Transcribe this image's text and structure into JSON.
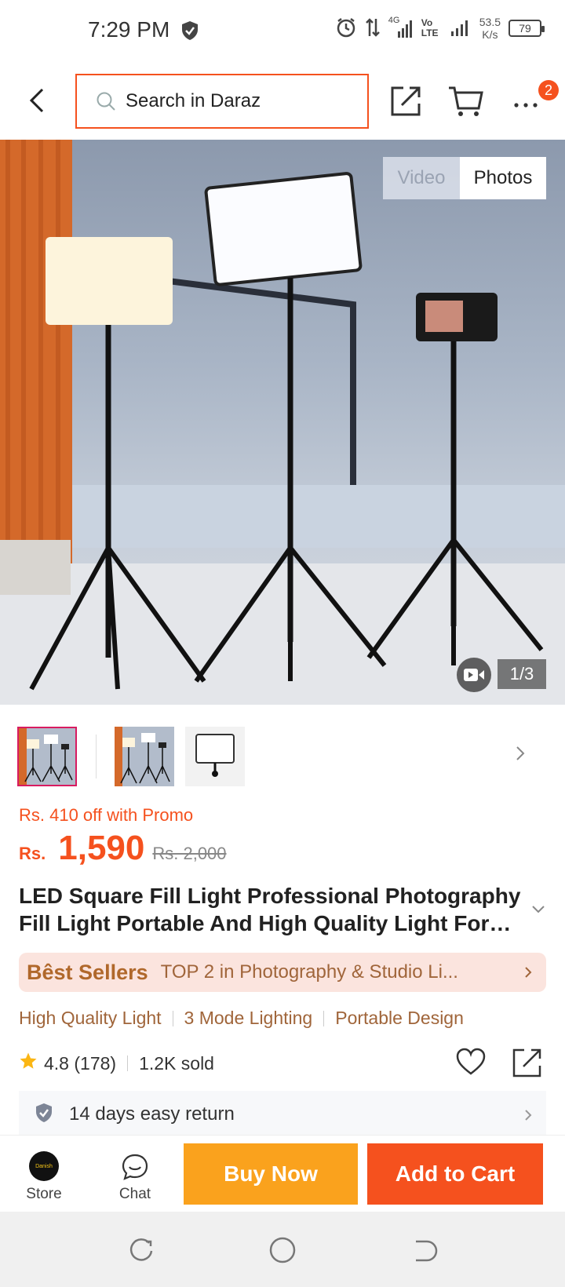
{
  "status_bar": {
    "time": "7:29 PM",
    "network_label_4g": "4G",
    "volte_label": "Vo LTE",
    "speed_value": "53.5",
    "speed_unit": "K/s",
    "battery": "79"
  },
  "header": {
    "search_placeholder": "Search in Daraz",
    "cart_badge": "2"
  },
  "gallery": {
    "tab_video": "Video",
    "tab_photos": "Photos",
    "counter": "1/3",
    "selected_thumbnail": 1
  },
  "price": {
    "promo_text": "Rs. 410 off with Promo",
    "currency": "Rs.",
    "current": "1,590",
    "original": "Rs. 2,000"
  },
  "product": {
    "title": "LED Square Fill Light Professional Photography Fill Light Portable And High Quality Light For…"
  },
  "best_sellers": {
    "label_prefix": "B",
    "label_rest": "st Sellers",
    "label_crown_e": "ê",
    "text": "TOP 2 in Photography & Studio Li..."
  },
  "features": [
    "High Quality Light",
    "3 Mode Lighting",
    "Portable Design"
  ],
  "rating": {
    "score": "4.8",
    "count": "(178)",
    "sold": "1.2K sold"
  },
  "return_policy": {
    "text": "14 days easy return"
  },
  "bottom_bar": {
    "store_label": "Store",
    "store_logo_text": "Danish",
    "chat_label": "Chat",
    "buy_now": "Buy Now",
    "add_to_cart": "Add to Cart"
  },
  "colors": {
    "accent": "#f5511e",
    "buy_now": "#faa21d",
    "best_seller_bg": "#fbe4de",
    "feature_text": "#a0653a"
  },
  "icons": [
    "back-arrow-icon",
    "search-icon",
    "share-icon",
    "cart-icon",
    "more-icon",
    "video-icon",
    "chevron-right-icon",
    "chevron-down-icon",
    "star-icon",
    "heart-icon",
    "shield-check-icon",
    "chat-icon"
  ]
}
